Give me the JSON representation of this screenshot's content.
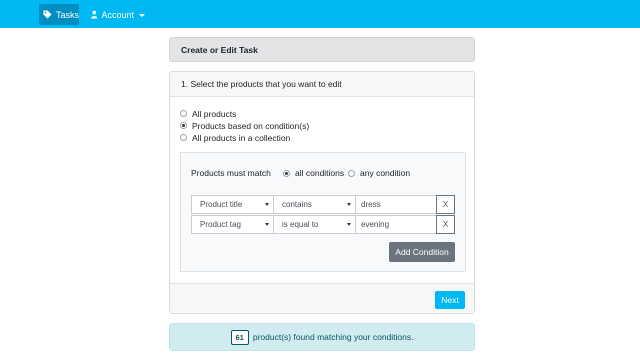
{
  "navbar": {
    "tasks_label": "Tasks",
    "account_label": "Account",
    "tasks_icon": "tag-icon",
    "account_icon": "user-icon",
    "bg_color": "#00b9f2"
  },
  "page": {
    "title": "Create or Edit Task"
  },
  "step": {
    "header": "1. Select the products that you want to edit",
    "options": [
      {
        "label": "All products",
        "checked": false
      },
      {
        "label": "Products based on condition(s)",
        "checked": true
      },
      {
        "label": "All products in a collection",
        "checked": false
      }
    ]
  },
  "conditions": {
    "match_label": "Products must match",
    "match_options": [
      {
        "label": "all conditions",
        "checked": true
      },
      {
        "label": "any condition",
        "checked": false
      }
    ],
    "rows": [
      {
        "field": "Product title",
        "operator": "contains",
        "value": "dress",
        "remove_label": "X"
      },
      {
        "field": "Product tag",
        "operator": "is equal to",
        "value": "evening",
        "remove_label": "X"
      }
    ],
    "add_label": "Add Condition"
  },
  "footer": {
    "next_label": "Next"
  },
  "result": {
    "count": "61",
    "text": "product(s) found matching your conditions."
  }
}
